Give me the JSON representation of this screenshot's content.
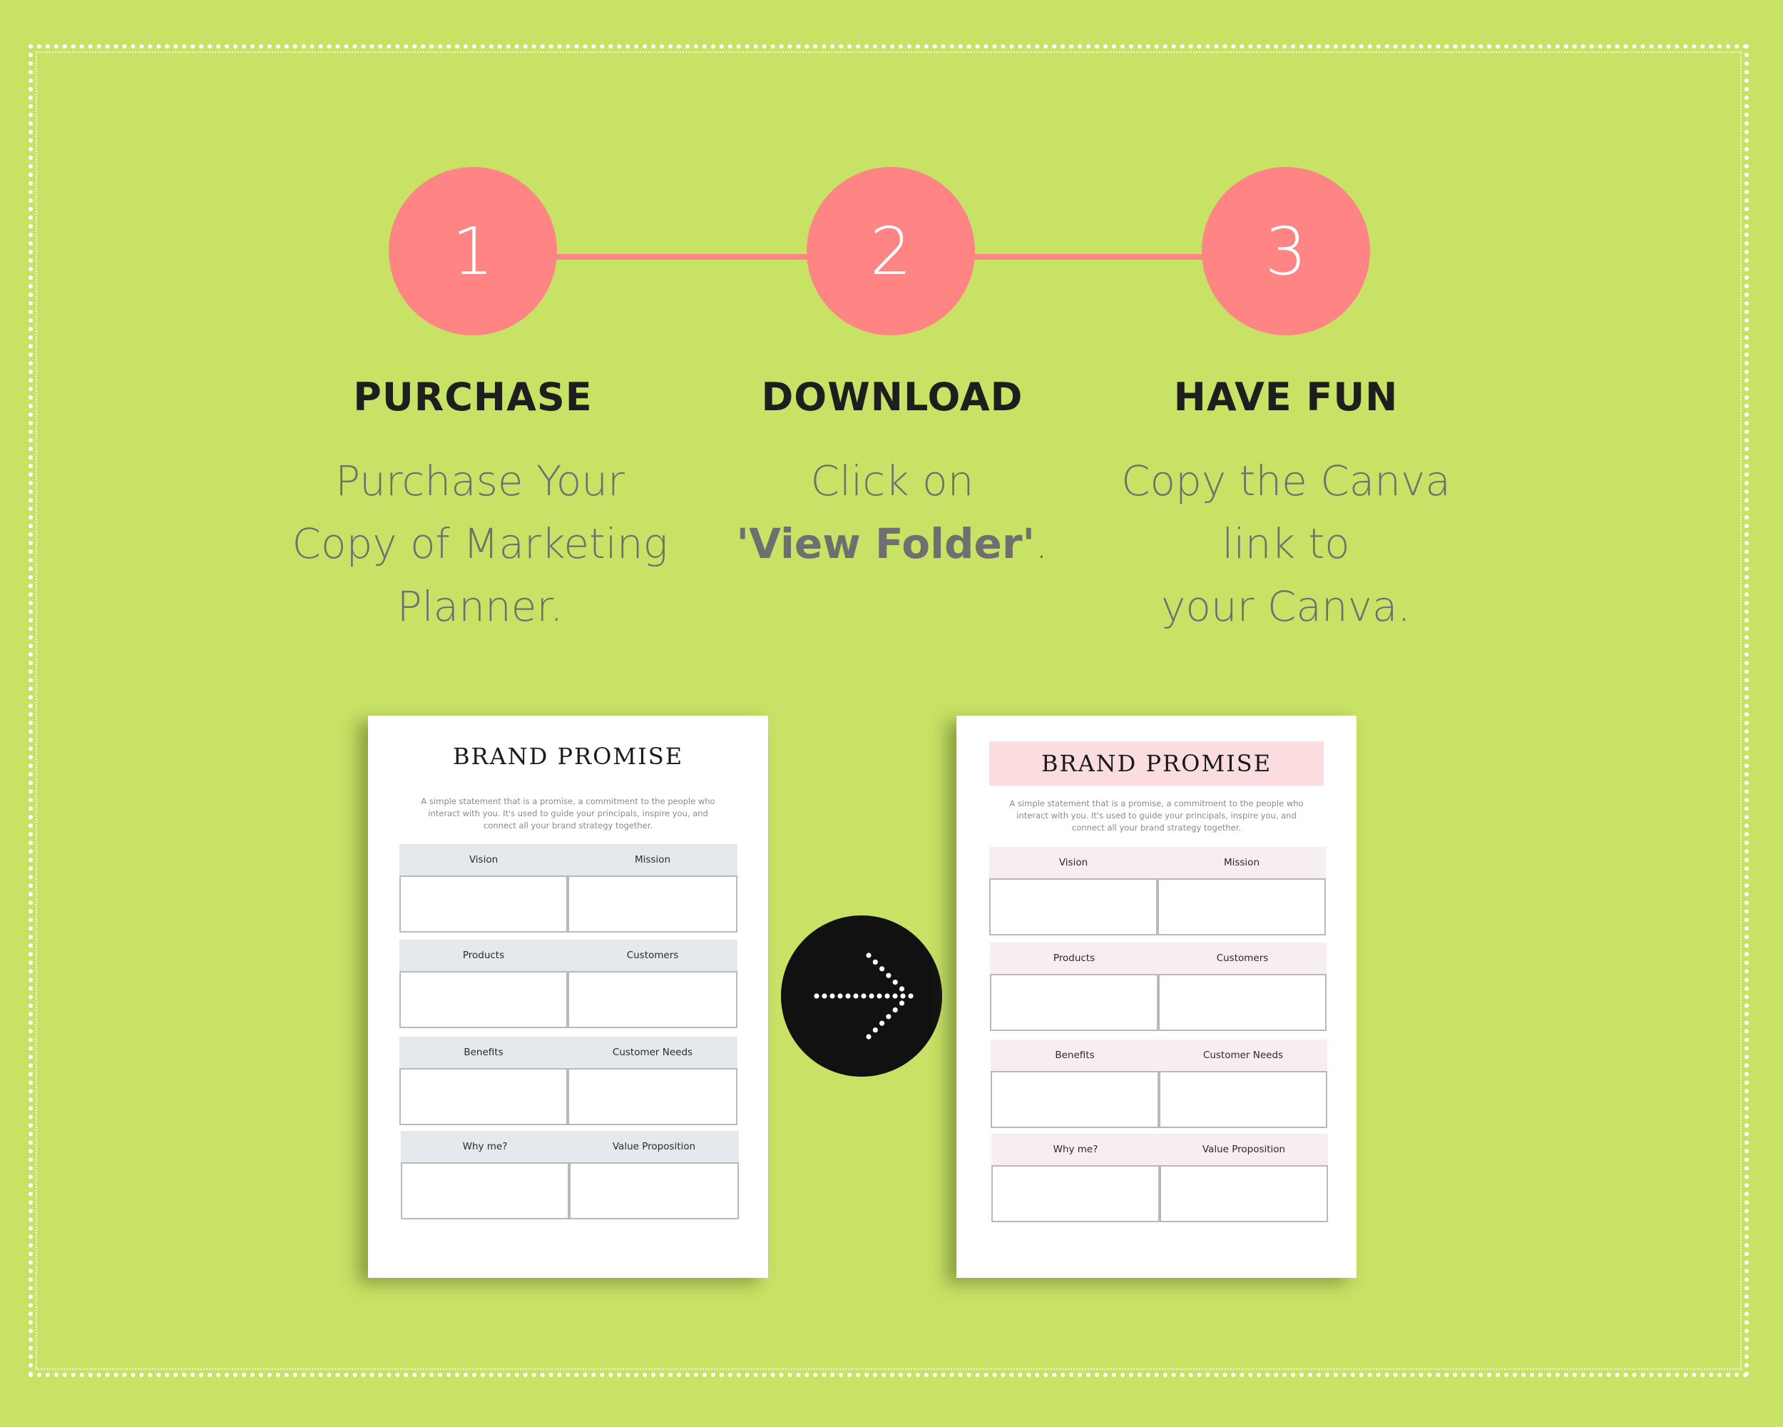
{
  "colors": {
    "background": "#c8e266",
    "accent": "#ff8484",
    "title_text": "#1e1e1e",
    "body_text": "#6f6f6f",
    "arrow_circle": "#111111",
    "pink_band": "#fbdde0"
  },
  "steps": [
    {
      "number": "1",
      "title": "PURCHASE",
      "lines": [
        "Purchase Your",
        "Copy of Marketing",
        "Planner."
      ]
    },
    {
      "number": "2",
      "title": "DOWNLOAD",
      "line1": "Click  on",
      "line2_bold": "'View Folder'",
      "line2_suffix": "."
    },
    {
      "number": "3",
      "title": "HAVE FUN",
      "lines": [
        "Copy the Canva",
        "link to",
        "your Canva."
      ]
    }
  ],
  "arrow": {
    "icon": "dotted-arrow-right-icon"
  },
  "pages": [
    {
      "variant": "plain",
      "title": "BRAND PROMISE",
      "description": "A simple statement that is a promise, a commitment to the people who interact with you. It's used to guide your principals, inspire you, and connect all your brand strategy together.",
      "cells": [
        "Vision",
        "Mission",
        "Products",
        "Customers",
        "Benefits",
        "Customer Needs",
        "Why me?",
        "Value Proposition"
      ]
    },
    {
      "variant": "pink",
      "title": "BRAND PROMISE",
      "description": "A simple statement that is a promise, a commitment to the people who interact with you. It's used to guide your principals, inspire you, and connect all your brand strategy together.",
      "cells": [
        "Vision",
        "Mission",
        "Products",
        "Customers",
        "Benefits",
        "Customer Needs",
        "Why me?",
        "Value Proposition"
      ]
    }
  ]
}
